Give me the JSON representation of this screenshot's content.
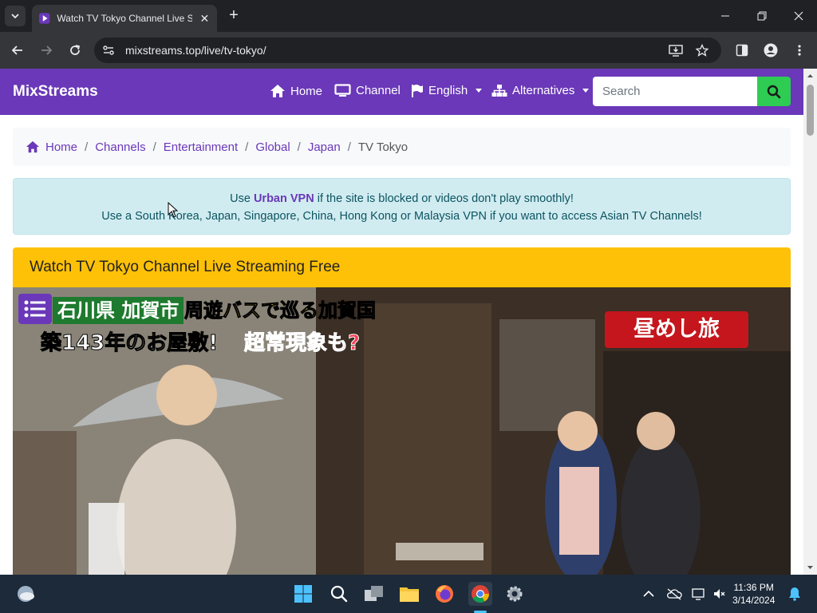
{
  "browser": {
    "tab_title": "Watch TV Tokyo Channel Live S",
    "url": "mixstreams.top/live/tv-tokyo/"
  },
  "site": {
    "brand": "MixStreams",
    "nav": {
      "home": "Home",
      "channel": "Channel",
      "language": "English",
      "alternatives": "Alternatives"
    },
    "search_placeholder": "Search"
  },
  "breadcrumbs": [
    "Home",
    "Channels",
    "Entertainment",
    "Global",
    "Japan",
    "TV Tokyo"
  ],
  "notice": {
    "line1_pre": "Use ",
    "line1_link": "Urban VPN",
    "line1_post": " if the site is blocked or videos don't play smoothly!",
    "line2": "Use a South Korea, Japan, Singapore, China, Hong Kong or Malaysia VPN if you want to access Asian TV Channels!"
  },
  "card_title": "Watch TV Tokyo Channel Live Streaming Free",
  "video": {
    "caption_line1a": "石川県 加賀市",
    "caption_line1b": "周遊バスで巡る加賀国",
    "caption_line2a": "築143年のお屋敷!",
    "caption_line2b": "超常現象も?",
    "logo": "昼めし旅"
  },
  "taskbar": {
    "time": "11:36 PM",
    "date": "3/14/2024"
  },
  "colors": {
    "brand_purple": "#6a38b8",
    "card_yellow": "#ffc107",
    "search_green": "#2ecc52"
  }
}
